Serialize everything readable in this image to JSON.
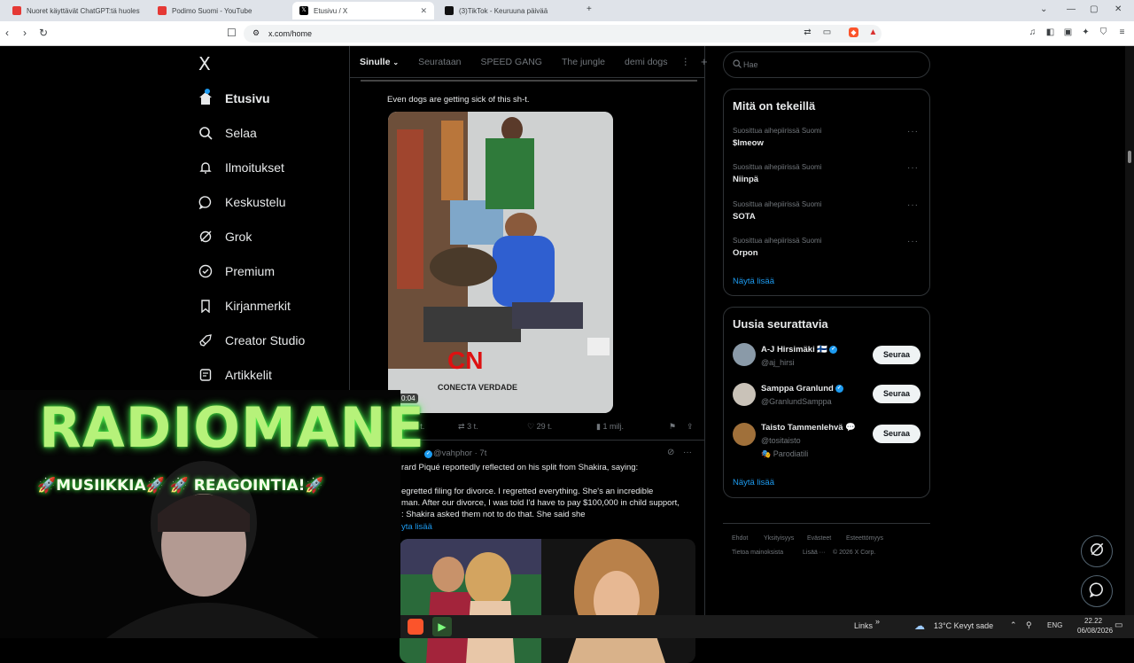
{
  "browser": {
    "tabs": [
      {
        "title": "Nuoret käyttävät ChatGPT:tä huolest"
      },
      {
        "title": "Podimo Suomi - YouTube"
      },
      {
        "title": "Etusivu / X"
      },
      {
        "title": "(3)TikTok - Keuruuna päivää"
      }
    ],
    "new_tab": "+",
    "url": "x.com/home"
  },
  "sidebar": {
    "logo": "X",
    "items": [
      {
        "label": "Etusivu",
        "icon": "home-icon"
      },
      {
        "label": "Selaa",
        "icon": "search-icon"
      },
      {
        "label": "Ilmoitukset",
        "icon": "bell-icon"
      },
      {
        "label": "Keskustelu",
        "icon": "chat-icon"
      },
      {
        "label": "Grok",
        "icon": "grok-icon"
      },
      {
        "label": "Premium",
        "icon": "premium-icon"
      },
      {
        "label": "Kirjanmerkit",
        "icon": "bookmark-icon"
      },
      {
        "label": "Creator Studio",
        "icon": "rocket-icon"
      },
      {
        "label": "Artikkelit",
        "icon": "article-icon"
      }
    ]
  },
  "timeline": {
    "tabs": [
      "Sinulle",
      "Seurataan",
      "SPEED GANG",
      "The jungle",
      "demi dogs"
    ],
    "add_tab": "+",
    "tweet1": {
      "text": "Even dogs are getting sick of this sh-t.",
      "video_time": "0:04",
      "watermark": "CONECTA VERDADE",
      "replies": "2 t.",
      "reposts": "3 t.",
      "likes": "29 t.",
      "views": "1 milj."
    },
    "tweet2": {
      "handle": "@vahphor · 7t",
      "line1": "rard Piqué reportedly reflected on his split from Shakira, saying:",
      "body": [
        "egretted filing for divorce. I regretted everything. She's an incredible",
        "man. After our divorce, I was told I'd have to pay $100,000 in child support,",
        ": Shakira asked them not to do that. She said she"
      ],
      "show_more": "yta lisää"
    }
  },
  "right": {
    "search_placeholder": "Hae",
    "trends_title": "Mitä on tekeillä",
    "trends": [
      {
        "context": "Suosittua aihepiirissä Suomi",
        "name": "$lmeow"
      },
      {
        "context": "Suosittua aihepiirissä Suomi",
        "name": "Niinpä"
      },
      {
        "context": "Suosittua aihepiirissä Suomi",
        "name": "SOTA"
      },
      {
        "context": "Suosittua aihepiirissä Suomi",
        "name": "Orpon"
      }
    ],
    "trends_more": "Näytä lisää",
    "follow_title": "Uusia seurattavia",
    "follow": [
      {
        "name": "A-J Hirsimäki 🇫🇮",
        "handle": "@aj_hirsi",
        "button": "Seuraa",
        "color": "#8a9aa8"
      },
      {
        "name": "Samppa Granlund",
        "handle": "@GranlundSamppa",
        "button": "Seuraa",
        "color": "#c9c2b8"
      },
      {
        "name": "Taisto Tammenlehvä 💬",
        "handle": "@tositaisto",
        "extra": "🎭 Parodiatili",
        "button": "Seuraa",
        "color": "#a0703a"
      }
    ],
    "follow_more": "Näytä lisää",
    "footer": [
      "Ehdot",
      "Yksityisyys",
      "Evästeet",
      "Esteettömyys",
      "Tietoa mainoksista",
      "Lisää ···",
      "© 2026 X Corp."
    ]
  },
  "overlay": {
    "title": "RADIOMANE",
    "subtitle": "🚀MUSIIKKIA🚀 🚀 REAGOINTIA!🚀"
  },
  "taskbar": {
    "links": "Links",
    "weather": "13°C  Kevyt sade",
    "lang": "ENG",
    "time": "22.22",
    "date": "06/08/2026"
  },
  "colors": {
    "accent": "#1d9bf0",
    "overlay_green": "#b6f27a"
  }
}
